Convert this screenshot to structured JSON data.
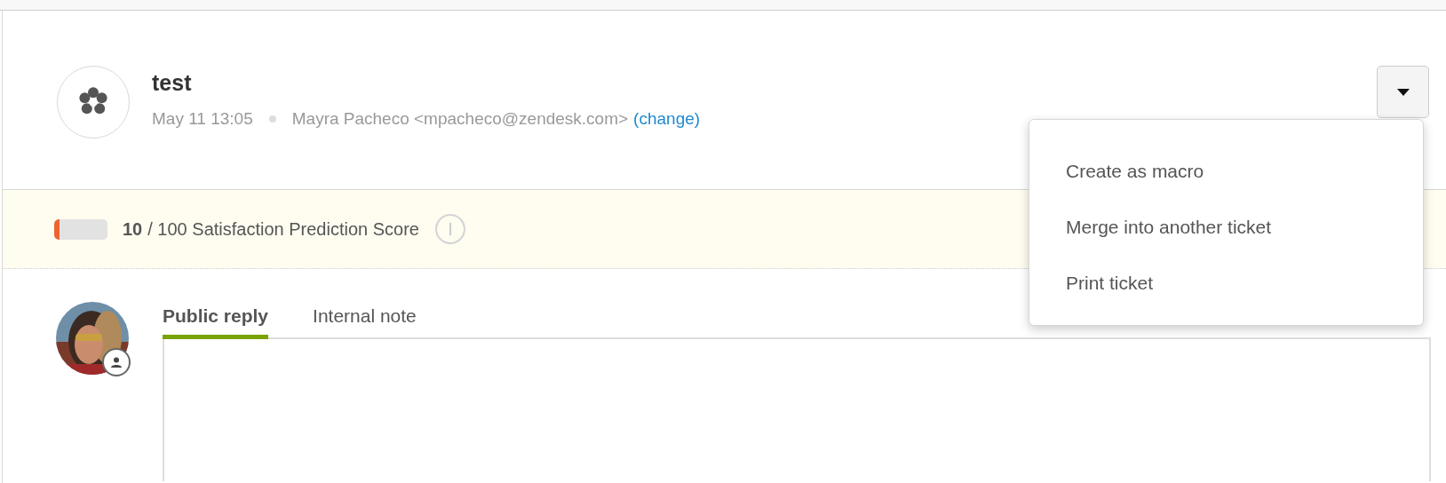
{
  "ticket": {
    "title": "test",
    "date": "May 11 13:05",
    "requester": "Mayra Pacheco <mpacheco@zendesk.com>",
    "change_link": "(change)"
  },
  "actions_menu": {
    "expanded": true,
    "items": [
      "Create as macro",
      "Merge into another ticket",
      "Print ticket"
    ]
  },
  "satisfaction": {
    "level": 0.1,
    "score": "10",
    "label": "/ 100 Satisfaction Prediction Score"
  },
  "composer": {
    "tabs": [
      {
        "label": "Public reply",
        "selected": true
      },
      {
        "label": "Internal note",
        "selected": false
      }
    ]
  }
}
